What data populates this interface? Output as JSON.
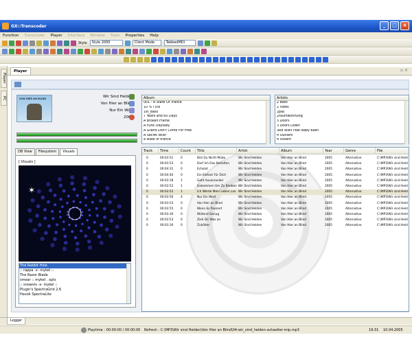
{
  "window": {
    "title": "GX::Transcoder"
  },
  "menu": [
    {
      "label": "Function",
      "enabled": true
    },
    {
      "label": "Transcoder",
      "enabled": false
    },
    {
      "label": "Player",
      "enabled": true
    },
    {
      "label": "Interface",
      "enabled": false
    },
    {
      "label": "Window",
      "enabled": false
    },
    {
      "label": "Tools",
      "enabled": false
    },
    {
      "label": "Properties",
      "enabled": true
    },
    {
      "label": "Help",
      "enabled": true
    }
  ],
  "toolbar": {
    "style_label": "Style",
    "style_value": "Style 2000",
    "mode_value": "Client Mode",
    "layout_value": "TabbedMDI"
  },
  "left_dock": {
    "tab1": "Player",
    "tab2": "PC"
  },
  "player_tab": "Player",
  "track_info": {
    "artist": "Wir Sind Helden",
    "album": "Von Hier an Blind",
    "title": "Nur Ein Wort",
    "year": "2005",
    "cover_text": "VON HIER AN BLIND"
  },
  "progress": {
    "bar1": 1.0,
    "bar2": 1.0
  },
  "view_tabs": [
    "DB View",
    "Filesystem",
    "Visuals"
  ],
  "active_view_tab": 2,
  "visuals": {
    "group_label": "[ Visuals ]",
    "items": [
      "The Rabbit Hole",
      ":: rappa -x- mykel ::",
      "The Razor Blade",
      "smear :: mykel . xplo",
      ":: snowvis -x- mykel ::",
      "Plugin's SpectraGrid 2.6",
      "Havok SpectraLite"
    ],
    "selected_index": 0
  },
  "albums": {
    "header": "Album",
    "items": [
      "001 - A State Of Trance",
      "10 % I Dis",
      "1st_Bass",
      "7 Years and 60 Days",
      "A Broken Frame",
      "A Funk Odyssey",
      "A Grand Don't Come For Free",
      "A Secret Wish",
      "a state of trance"
    ]
  },
  "artists": {
    "header": "Artists",
    "items": [
      "2 Bass",
      "2 Vibes",
      "2pac",
      "2raumwohnung",
      "3 Doors",
      "3 Doors Down",
      "3Rd Wish Feat Baby Bash",
      "4 Outliers",
      "4 Violent"
    ]
  },
  "table": {
    "columns": [
      "Track",
      "Time",
      "Count",
      "Title",
      "Artist",
      "Album",
      "Year",
      "Genre",
      "File"
    ],
    "selected_index": 6,
    "rows": [
      [
        "0",
        "00:03:51",
        "0",
        "Bist Du Nicht Müde",
        "Wir Sind Helden",
        "Von Hier an Blind",
        "2005",
        "Alternative",
        "C:\\MP3\\Wir sind Held"
      ],
      [
        "0",
        "00:03:53",
        "0",
        "Darf Ich Das Behalten",
        "Wir Sind Helden",
        "Von Hier an Blind",
        "2005",
        "Alternative",
        "C:\\MP3\\Wir sind Held"
      ],
      [
        "0",
        "00:04:31",
        "0",
        "Echolot",
        "Wir Sind Helden",
        "Von Hier an Blind",
        "2005",
        "Alternative",
        "C:\\MP3\\Wir sind Held"
      ],
      [
        "0",
        "00:04:40",
        "0",
        "Ein Elefant Für Dich",
        "Wir Sind Helden",
        "Von Hier an Blind",
        "2005",
        "Alternative",
        "C:\\MP3\\Wir sind Held"
      ],
      [
        "0",
        "00:03:18",
        "1",
        "Geht Auseinander",
        "Wir Sind Helden",
        "Von Hier an Blind",
        "2005",
        "Alternative",
        "C:\\MP3\\Wir sind Held"
      ],
      [
        "0",
        "00:03:52",
        "1",
        "Gekommen Um Zu Bleiben",
        "Wir Sind Helden",
        "Von Hier an Blind",
        "2005",
        "Alternative",
        "C:\\MP3\\Wir sind Held"
      ],
      [
        "0",
        "00:03:52",
        "1",
        "Ich Werde Mein Leben Lan",
        "Wir Sind Helden",
        "Von Hier an Blind",
        "2005",
        "Alternative",
        "C:\\MP3\\Wir sind Held"
      ],
      [
        "0",
        "00:03:56",
        "4",
        "Nur Ein Wort",
        "Wir Sind Helden",
        "Von Hier an Blind",
        "2005",
        "Alternative",
        "C:\\MP3\\Wir sind Held"
      ],
      [
        "0",
        "00:03:53",
        "0",
        "Von Hier an Blind",
        "Wir Sind Helden",
        "Von Hier an Blind",
        "2005",
        "Alternative",
        "C:\\MP3\\Wir sind Held"
      ],
      [
        "0",
        "00:03:55",
        "0",
        "Wenn Es Passiert",
        "Wir Sind Helden",
        "Von Hier an Blind",
        "2005",
        "Alternative",
        "C:\\MP3\\Wir sind Held"
      ],
      [
        "0",
        "00:03:30",
        "0",
        "Wütend Genug",
        "Wir Sind Helden",
        "Von Hier an Blind",
        "2005",
        "Alternative",
        "C:\\MP3\\Wir sind Held"
      ],
      [
        "0",
        "00:03:53",
        "0",
        "Zieh Dir Was an",
        "Wir Sind Helden",
        "Von Hier an Blind",
        "2005",
        "Alternative",
        "C:\\MP3\\Wir sind Held"
      ],
      [
        "0",
        "00:03:30",
        "0",
        "Zuhälter",
        "Wir Sind Helden",
        "Von Hier an Blind",
        "2005",
        "Alternative",
        "C:\\MP3\\Wir sind Held"
      ]
    ]
  },
  "logger_tab": "Logger",
  "status": {
    "playtime": "Playtime : 00:00:00 / 00:00:00",
    "refresh": "Refresh : C:\\MP3\\Wir sind Helden\\Von Hier an Blind\\04-wir_sind_helden-zuhaelter-mip.mp3",
    "time": "19:31",
    "date": "10.04.2005"
  },
  "colors": {
    "titlebar": "#1e57c9",
    "accent_select": "#316ac5",
    "progress": "#2ea92e",
    "vis_bg": "#05081a",
    "vis_points": "#4a4cff"
  }
}
